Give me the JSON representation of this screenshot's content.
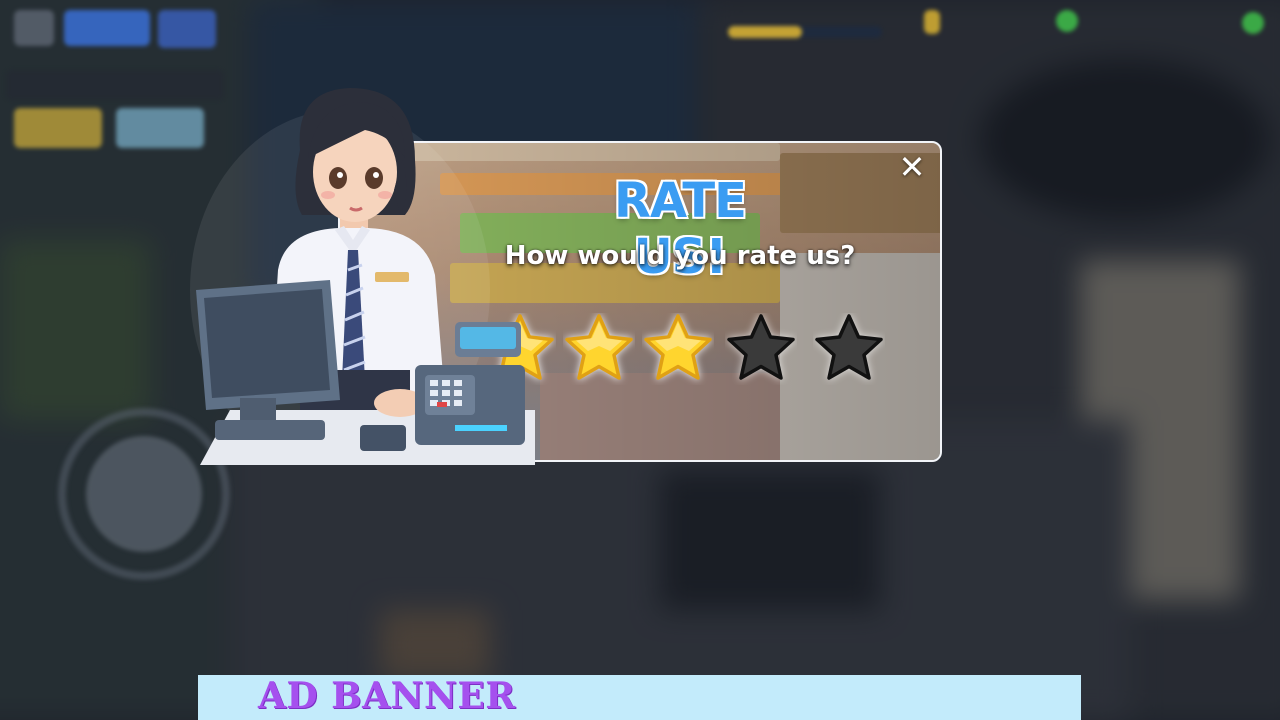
{
  "popup": {
    "title": "RATE US!",
    "subtitle": "How would you rate us?",
    "close_symbol": "✕"
  },
  "rating": {
    "max": 5,
    "filled": 3,
    "filled_color": "#ffd52e",
    "empty_color": "#3a3a3a"
  },
  "ad_banner": {
    "label": "AD BANNER",
    "text_color": "#a550ee",
    "background": "#c3ebfb"
  },
  "icons": {
    "close": "close-icon",
    "star": "star-icon",
    "cashier": "cashier-illustration"
  },
  "colors": {
    "title": "#3a9cf2",
    "popup_border": "#f2f4f8"
  }
}
